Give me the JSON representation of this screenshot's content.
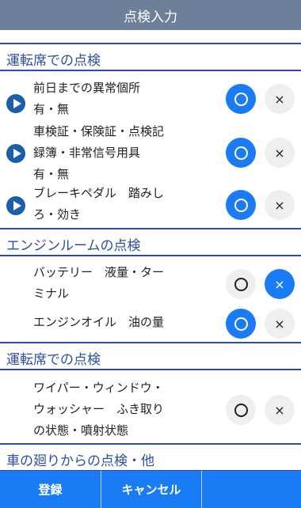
{
  "header": {
    "title": "点検入力"
  },
  "sections": [
    {
      "title": "運転席での点検",
      "items": [
        {
          "lines": [
            "前日までの異常個所",
            "有・無"
          ],
          "ok_selected": true
        },
        {
          "lines": [
            "車検証・保険証・点検記",
            "録簿・非常信号用具",
            "有・無"
          ],
          "ok_selected": true
        },
        {
          "lines": [
            "ブレーキペダル　踏みし",
            "ろ・効き"
          ],
          "ok_selected": true
        }
      ]
    },
    {
      "title": "エンジンルームの点検",
      "items": [
        {
          "lines": [
            "バッテリー　液量・ター",
            "ミナル"
          ],
          "ok_selected": false
        },
        {
          "lines": [
            "エンジンオイル　油の量"
          ],
          "ok_selected": true
        }
      ]
    },
    {
      "title": "運転席での点検",
      "items": [
        {
          "lines": [
            "ワイパー・ウィンドウ・",
            "ウォッシャー　ふき取り",
            "の状態・噴射状態"
          ],
          "ok_selected": null
        }
      ]
    },
    {
      "title": "車の廻りからの点検・他",
      "items": []
    }
  ],
  "buttons": {
    "ok_symbol": "○",
    "ng_symbol": "×"
  },
  "footer": {
    "register": "登録",
    "cancel": "キャンセル",
    "empty": ""
  }
}
